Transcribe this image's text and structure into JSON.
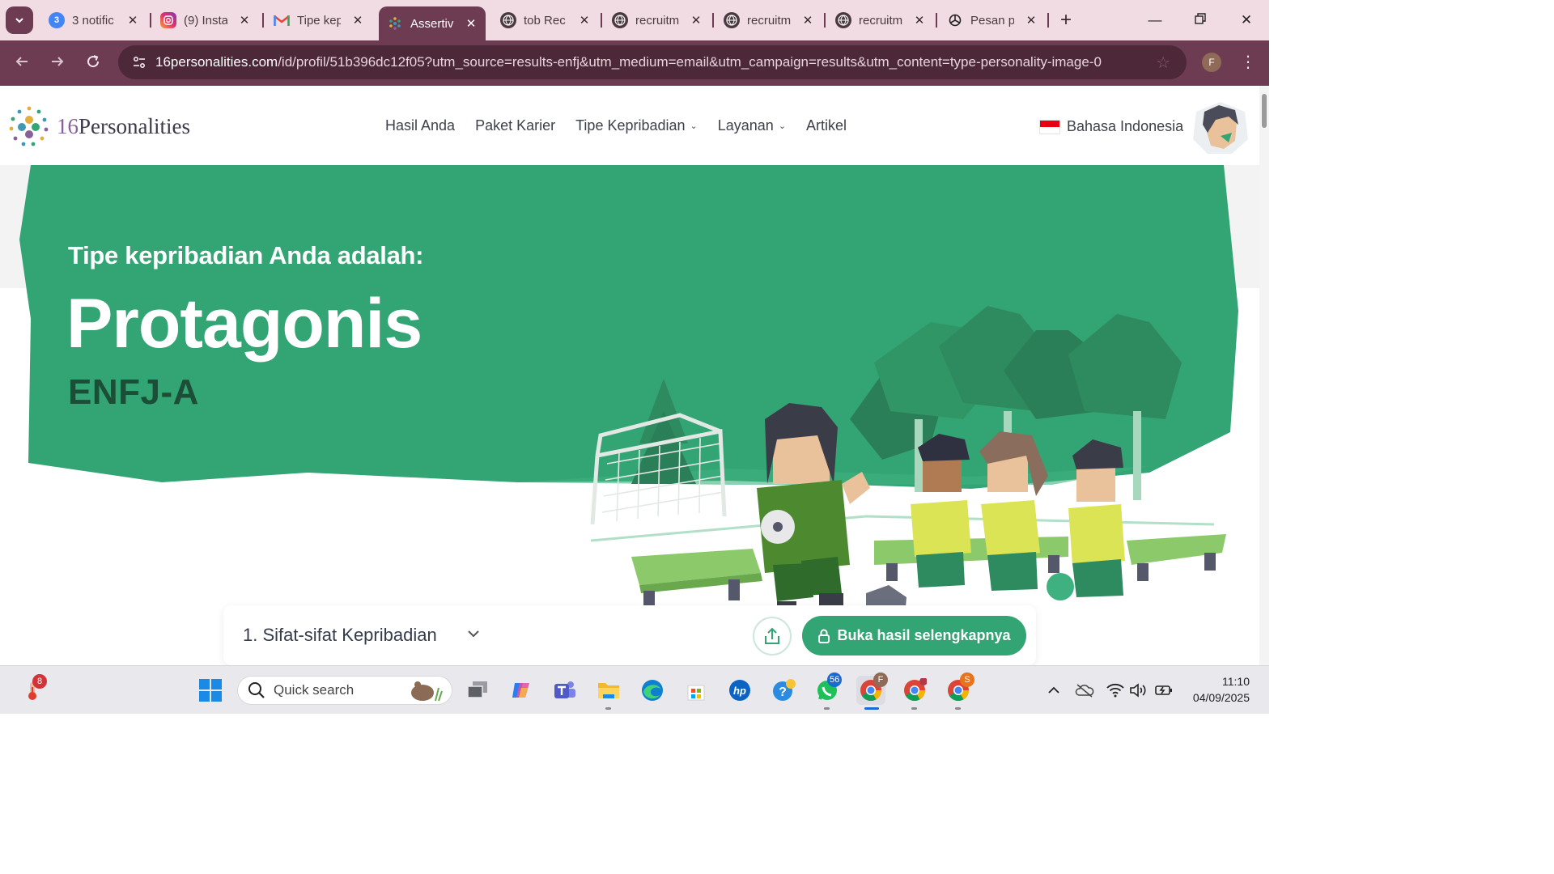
{
  "browser": {
    "tabs": [
      {
        "title": "3 notific",
        "badge": "3"
      },
      {
        "title": "(9) Insta"
      },
      {
        "title": "Tipe kep"
      },
      {
        "title": "Assertiv",
        "active": true
      },
      {
        "title": "tob Rec"
      },
      {
        "title": "recruitm"
      },
      {
        "title": "recruitm"
      },
      {
        "title": "recruitm"
      },
      {
        "title": "Pesan p"
      }
    ],
    "url_host": "16personalities.com",
    "url_path": "/id/profil/51b396dc12f05?utm_source=results-enfj&utm_medium=email&utm_campaign=results&utm_content=type-personality-image-0",
    "profile_initial": "F"
  },
  "site": {
    "logo_num": "16",
    "logo_word": "Personalities",
    "nav": [
      "Hasil Anda",
      "Paket Karier",
      "Tipe Kepribadian",
      "Layanan",
      "Artikel"
    ],
    "language": "Bahasa Indonesia"
  },
  "hero": {
    "subtitle": "Tipe kepribadian Anda adalah:",
    "type_name": "Protagonis",
    "type_code": "ENFJ-A",
    "accent_color": "#33a474",
    "code_color": "#1c4d36"
  },
  "section": {
    "title": "1. Sifat-sifat Kepribadian",
    "unlock_label": "Buka hasil selengkapnya"
  },
  "taskbar": {
    "search_placeholder": "Quick search",
    "weather_badge": "8",
    "whatsapp_badge": "56",
    "chrome_profile_1": "F",
    "chrome_profile_3": "S",
    "time": "11:10",
    "date": "04/09/2025"
  }
}
